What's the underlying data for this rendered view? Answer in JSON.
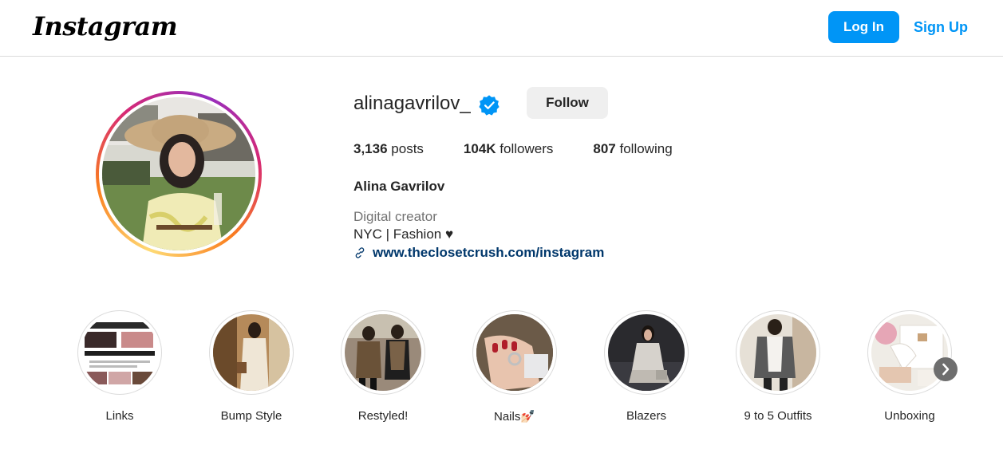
{
  "header": {
    "logo_text": "Instagram",
    "login_label": "Log In",
    "signup_label": "Sign Up"
  },
  "profile": {
    "username": "alinagavrilov_",
    "verified": true,
    "follow_label": "Follow",
    "stats": {
      "posts_count": "3,136",
      "posts_label": "posts",
      "followers_count": "104K",
      "followers_label": "followers",
      "following_count": "807",
      "following_label": "following"
    },
    "full_name": "Alina Gavrilov",
    "category": "Digital creator",
    "bio": "NYC | Fashion ♥",
    "link": "www.theclosetcrush.com/instagram"
  },
  "highlights": [
    {
      "label": "Links"
    },
    {
      "label": "Bump Style"
    },
    {
      "label": "Restyled!"
    },
    {
      "label": "Nails💅🏻"
    },
    {
      "label": "Blazers"
    },
    {
      "label": "9 to 5 Outfits"
    },
    {
      "label": "Unboxing"
    }
  ],
  "colors": {
    "primary_blue": "#0095f6",
    "link_blue": "#00376b",
    "verified_blue": "#0095f6",
    "follow_bg": "#efefef",
    "border": "#dbdbdb"
  },
  "icons": {
    "verified": "verified-badge-icon",
    "link": "link-chain-icon",
    "next": "chevron-right-icon"
  }
}
